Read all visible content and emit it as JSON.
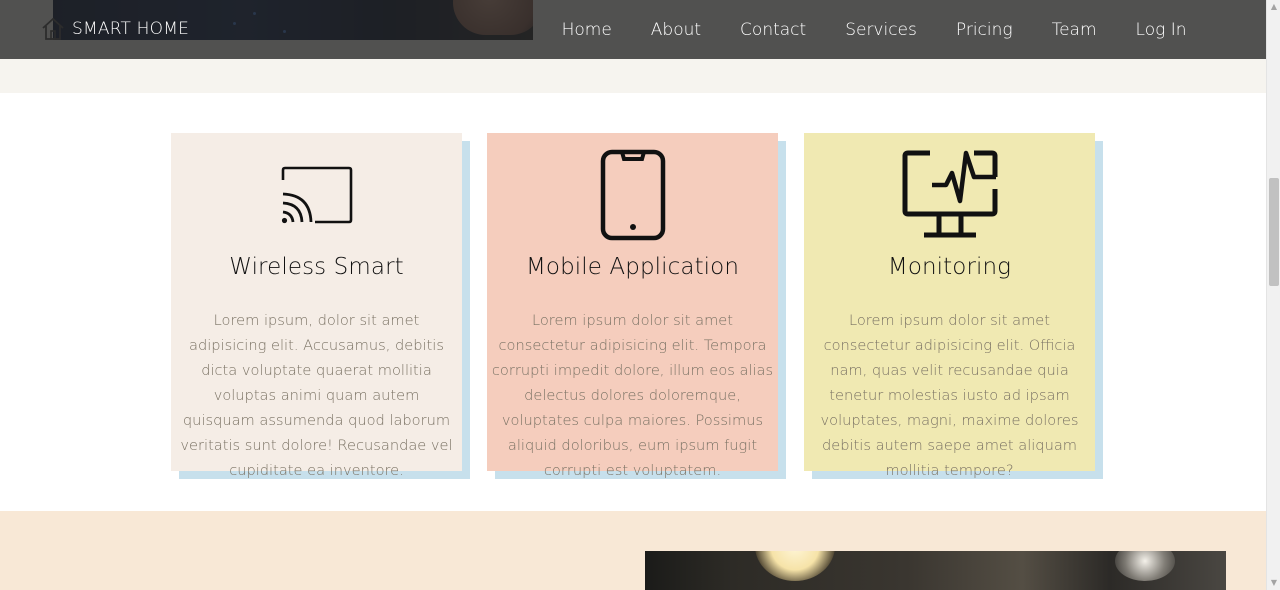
{
  "navbar": {
    "brand": "SMART HOME",
    "links": [
      "Home",
      "About",
      "Contact",
      "Services",
      "Pricing",
      "Team",
      "Log In"
    ]
  },
  "features": [
    {
      "icon": "cast-icon",
      "title": "Wireless Smart",
      "body": "Lorem ipsum, dolor sit amet adipisicing elit. Accusamus, debitis dicta voluptate quaerat mollitia voluptas animi quam autem quisquam assumenda quod laborum veritatis sunt dolore! Recusandae vel cupiditate ea inventore.",
      "bg": "#f5ede6"
    },
    {
      "icon": "smartphone-icon",
      "title": "Mobile Application",
      "body": "Lorem ipsum dolor sit amet consectetur adipisicing elit. Tempora corrupti impedit dolore, illum eos alias delectus dolores doloremque, voluptates culpa maiores. Possimus aliquid doloribus, eum ipsum fugit corrupti est voluptatem.",
      "bg": "#f5cdbd"
    },
    {
      "icon": "monitor-pulse-icon",
      "title": "Monitoring",
      "body": "Lorem ipsum dolor sit amet consectetur adipisicing elit. Officia nam, quas velit recusandae quia tenetur molestias iusto ad ipsam voluptates, magni, maxime dolores debitis autem saepe amet aliquam mollitia tempore?",
      "bg": "#f0e9b2"
    }
  ],
  "colors": {
    "navbar_bg": "#3a3a3a",
    "card_shadow": "#c7e0ec",
    "bottom_bg": "#f8e8d6",
    "hero_bg": "#f6f4ef"
  }
}
